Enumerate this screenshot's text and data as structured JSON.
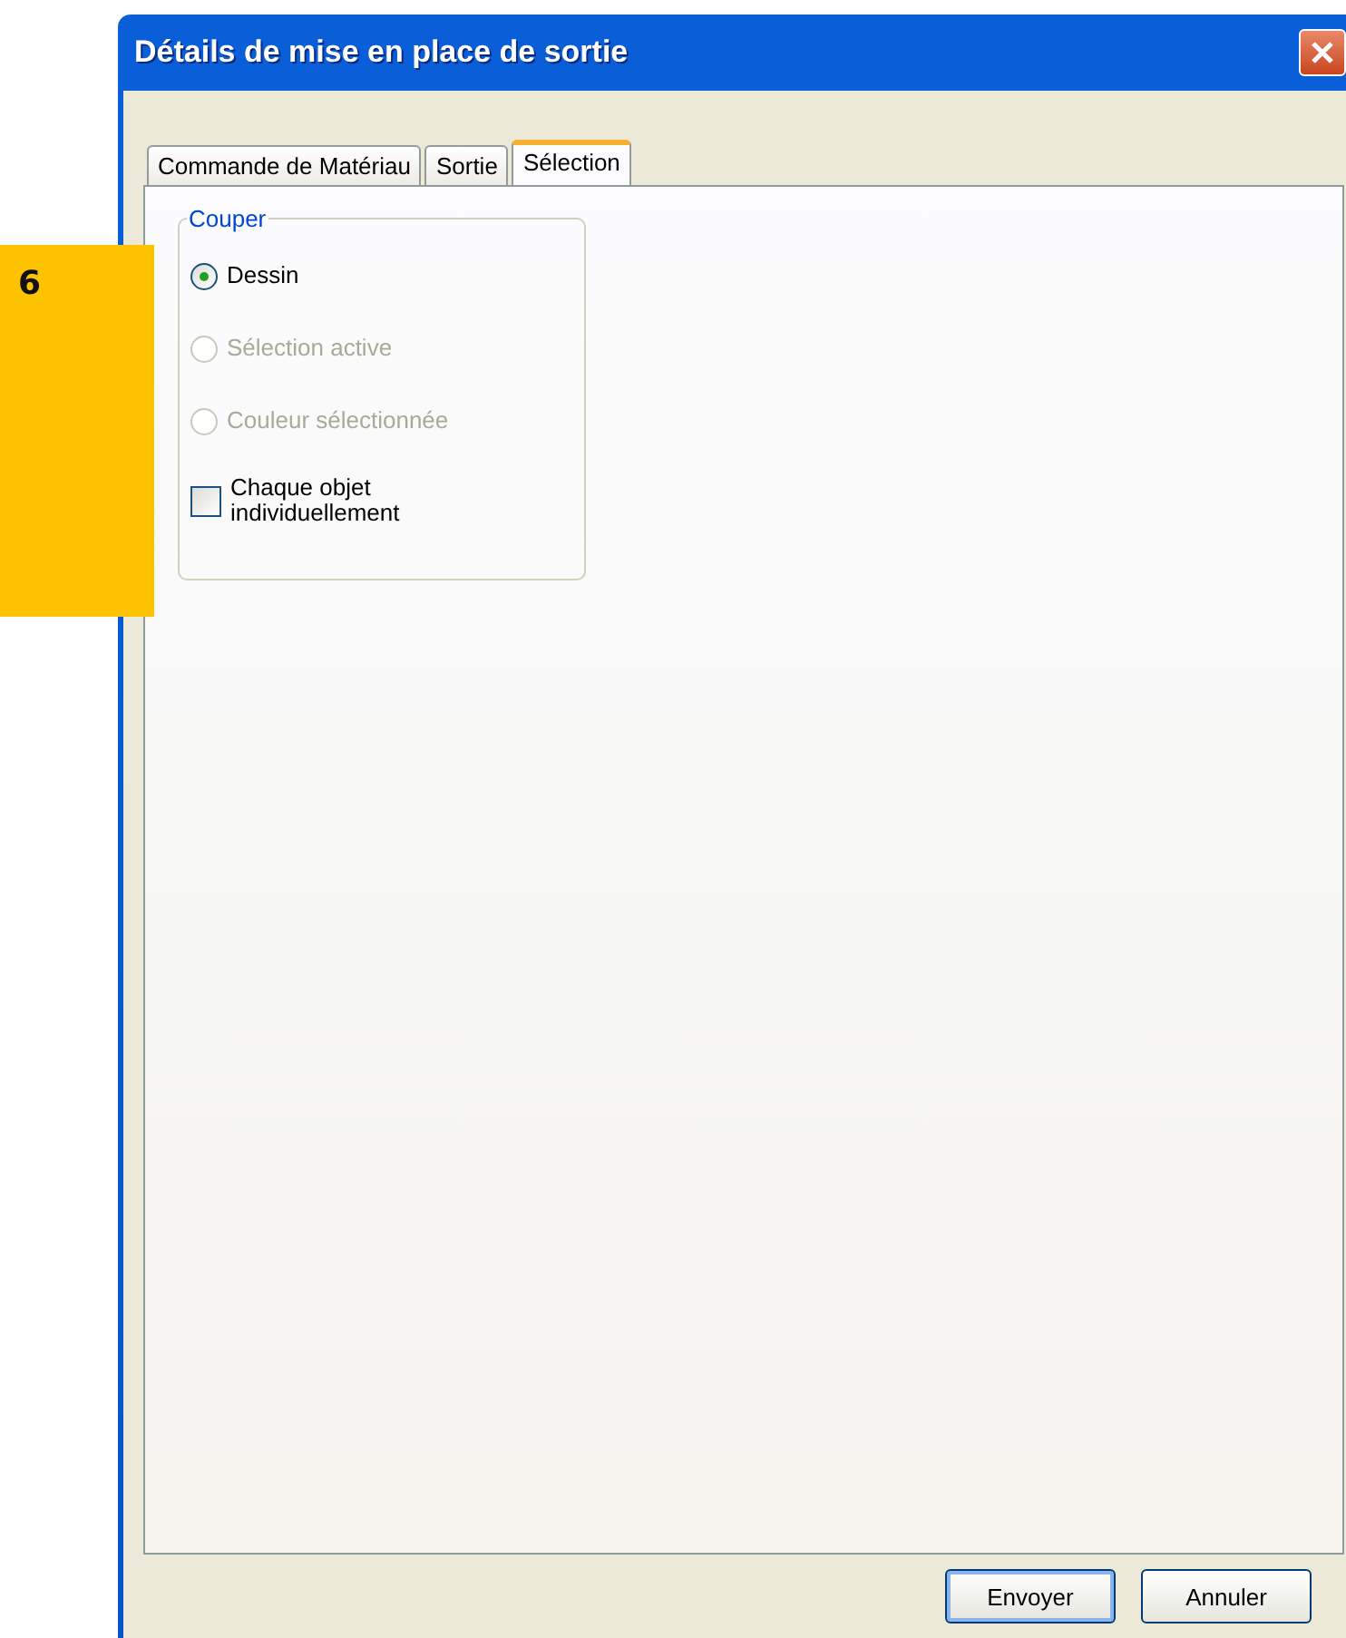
{
  "window": {
    "title": "Détails de mise en place de sortie"
  },
  "callout": {
    "label": "6"
  },
  "tabs": [
    {
      "label": "Commande de Matériau",
      "selected": false
    },
    {
      "label": "Sortie",
      "selected": false
    },
    {
      "label": "Sélection",
      "selected": true
    }
  ],
  "group": {
    "title": "Couper",
    "options": [
      {
        "kind": "radio",
        "label": "Dessin",
        "selected": true,
        "disabled": false
      },
      {
        "kind": "radio",
        "label": "Sélection active",
        "selected": false,
        "disabled": true
      },
      {
        "kind": "radio",
        "label": "Couleur sélectionnée",
        "selected": false,
        "disabled": true
      },
      {
        "kind": "checkbox",
        "label": "Chaque objet individuellement",
        "checked": false,
        "disabled": false
      }
    ]
  },
  "buttons": [
    {
      "label": "Envoyer",
      "default": true
    },
    {
      "label": "Annuler",
      "default": false
    }
  ]
}
